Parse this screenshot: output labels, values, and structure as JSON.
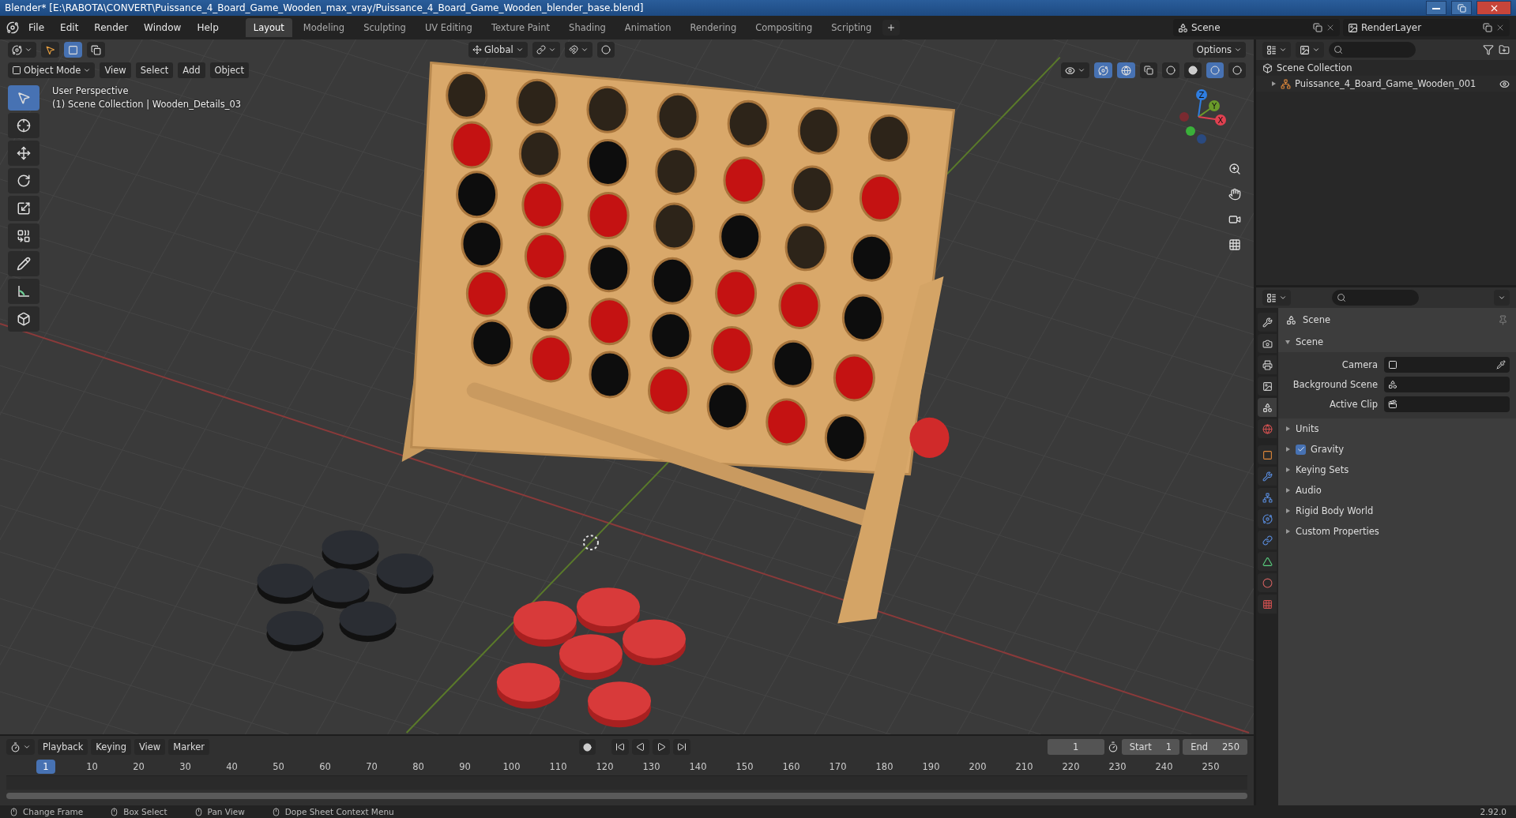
{
  "window": {
    "title": "Blender* [E:\\RABOTA\\CONVERT\\Puissance_4_Board_Game_Wooden_max_vray/Puissance_4_Board_Game_Wooden_blender_base.blend]"
  },
  "menu": [
    "File",
    "Edit",
    "Render",
    "Window",
    "Help"
  ],
  "workspaces": [
    {
      "label": "Layout",
      "selected": true
    },
    {
      "label": "Modeling",
      "selected": false
    },
    {
      "label": "Sculpting",
      "selected": false
    },
    {
      "label": "UV Editing",
      "selected": false
    },
    {
      "label": "Texture Paint",
      "selected": false
    },
    {
      "label": "Shading",
      "selected": false
    },
    {
      "label": "Animation",
      "selected": false
    },
    {
      "label": "Rendering",
      "selected": false
    },
    {
      "label": "Compositing",
      "selected": false
    },
    {
      "label": "Scripting",
      "selected": false
    }
  ],
  "scene": "Scene",
  "view_layer": "RenderLayer",
  "viewport": {
    "orientation": "Global",
    "options": "Options",
    "mode": "Object Mode",
    "menus": [
      "View",
      "Select",
      "Add",
      "Object"
    ],
    "overlay_text": [
      "User Perspective",
      "(1) Scene Collection | Wooden_Details_03"
    ],
    "tools": [
      {
        "selected": true
      },
      {
        "selected": false
      },
      {
        "selected": false
      },
      {
        "selected": false
      },
      {
        "selected": false
      },
      {
        "selected": false
      },
      {
        "selected": false
      },
      {
        "selected": false
      },
      {
        "selected": false
      }
    ],
    "shading": [
      {
        "selected": false
      },
      {
        "selected": false
      },
      {
        "selected": true
      },
      {
        "selected": false
      }
    ],
    "gizmo_axes": [
      "Z",
      "Y",
      "X"
    ]
  },
  "outliner": {
    "root": {
      "label": "Scene Collection",
      "children": [
        {
          "label": "Puissance_4_Board_Game_Wooden_001",
          "expanded": false,
          "visible": true
        }
      ]
    }
  },
  "properties": {
    "tabs": [
      {
        "selected": false
      },
      {
        "selected": false
      },
      {
        "selected": false
      },
      {
        "selected": false
      },
      {
        "selected": true
      },
      {
        "selected": false
      },
      {
        "selected": false
      },
      {
        "selected": false
      },
      {
        "selected": false
      },
      {
        "selected": false
      },
      {
        "selected": false
      },
      {
        "selected": false
      },
      {
        "selected": false
      },
      {
        "selected": false
      }
    ],
    "context": "Scene",
    "panel": {
      "title": "Scene",
      "expanded": true,
      "fields": [
        {
          "label": "Camera"
        },
        {
          "label": "Background Scene"
        },
        {
          "label": "Active Clip"
        }
      ]
    },
    "sections": [
      {
        "label": "Units",
        "kind": "plain",
        "expanded": false
      },
      {
        "label": "Gravity",
        "kind": "checkbox",
        "checked": true,
        "expanded": false
      },
      {
        "label": "Keying Sets",
        "kind": "plain",
        "expanded": false
      },
      {
        "label": "Audio",
        "kind": "plain",
        "expanded": false
      },
      {
        "label": "Rigid Body World",
        "kind": "plain",
        "expanded": false
      },
      {
        "label": "Custom Properties",
        "kind": "plain",
        "expanded": false
      }
    ]
  },
  "timeline": {
    "menus": [
      "Playback",
      "Keying",
      "View",
      "Marker"
    ],
    "current_frame": "1",
    "start_label": "Start",
    "start": "1",
    "end_label": "End",
    "end": "250",
    "marker": "1",
    "ticks": [
      "10",
      "20",
      "30",
      "40",
      "50",
      "60",
      "70",
      "80",
      "90",
      "100",
      "110",
      "120",
      "130",
      "140",
      "150",
      "160",
      "170",
      "180",
      "190",
      "200",
      "210",
      "220",
      "230",
      "240",
      "250"
    ]
  },
  "status_bar": {
    "hints": [
      "Change Frame",
      "Box Select",
      "Pan View",
      "Dope Sheet Context Menu"
    ],
    "version": "2.92.0"
  }
}
